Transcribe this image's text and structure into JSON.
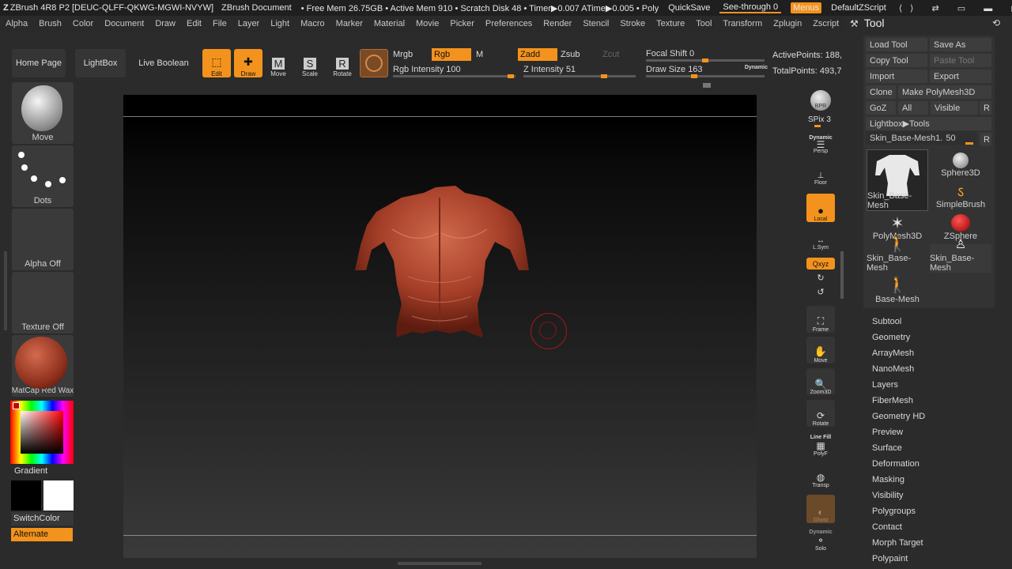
{
  "titlebar": {
    "app": "ZBrush 4R8 P2 [DEUC-QLFF-QKWG-MGWI-NVYW]",
    "document": "ZBrush Document",
    "mem": "• Free Mem 26.75GB • Active Mem 910 • Scratch Disk 48 • Timer▶0.007 ATime▶0.005 • Poly",
    "quicksave": "QuickSave",
    "seethrough": "See-through  0",
    "menus": "Menus",
    "zscript": "DefaultZScript"
  },
  "menubar": [
    "Alpha",
    "Brush",
    "Color",
    "Document",
    "Draw",
    "Edit",
    "File",
    "Layer",
    "Light",
    "Macro",
    "Marker",
    "Material",
    "Movie",
    "Picker",
    "Preferences",
    "Render",
    "Stencil",
    "Stroke",
    "Texture",
    "Tool",
    "Transform",
    "Zplugin",
    "Zscript"
  ],
  "shelf": {
    "home": "Home Page",
    "lightbox": "LightBox",
    "liveboolean": "Live Boolean",
    "edit": "Edit",
    "draw": "Draw",
    "move": "Move",
    "scale": "Scale",
    "rotate": "Rotate",
    "mrgb": "Mrgb",
    "rgb": "Rgb",
    "m": "M",
    "zadd": "Zadd",
    "zsub": "Zsub",
    "zcut": "Zcut",
    "rgb_intensity_label": "Rgb Intensity",
    "rgb_intensity": "100",
    "rgb_intensity_level": 1.0,
    "z_intensity_label": "Z Intensity",
    "z_intensity": "51",
    "z_intensity_level": 0.51,
    "focal_label": "Focal Shift",
    "focal": "0",
    "drawsize_label": "Draw Size",
    "drawsize": "163",
    "dynamic": "Dynamic",
    "activepoints": "ActivePoints: 188,",
    "totalpoints": "TotalPoints: 493,7"
  },
  "left": {
    "brush": "Move",
    "stroke": "Dots",
    "alpha": "Alpha Off",
    "texture": "Texture Off",
    "material": "MatCap Red Wax",
    "gradient": "Gradient",
    "switchcolor": "SwitchColor",
    "alternate": "Alternate"
  },
  "rightshelf": {
    "bpr": "BPR",
    "spix_label": "SPix",
    "spix": "3",
    "dynamic": "Dynamic",
    "persp": "Persp",
    "floor": "Floor",
    "local": "Local",
    "lsym": "L.Sym",
    "xyz": "Qxyz",
    "frame": "Frame",
    "move": "Move",
    "zoom": "Zoom3D",
    "rotate": "Rotate",
    "linefill": "Line Fill",
    "polyf": "PolyF",
    "transp": "Transp",
    "ghost": "Ghost",
    "dynamic2": "Dynamic",
    "solo": "Solo"
  },
  "toolpanel": {
    "title": "Tool",
    "load": "Load Tool",
    "saveas": "Save As",
    "copy": "Copy Tool",
    "paste": "Paste Tool",
    "import": "Import",
    "export": "Export",
    "clone": "Clone",
    "makepoly": "Make PolyMesh3D",
    "goz": "GoZ",
    "all": "All",
    "visible": "Visible",
    "r": "R",
    "lightboxtools": "Lightbox▶Tools",
    "current_label": "Skin_Base-Mesh1.",
    "current_value": "50",
    "r2": "R",
    "thumbs": [
      "Skin_Base-Mesh",
      "Sphere3D",
      "SimpleBrush",
      "PolyMesh3D",
      "ZSphere",
      "Skin_Base-Mesh",
      "Skin_Base-Mesh",
      "Base-Mesh"
    ]
  },
  "subpalettes": [
    "Subtool",
    "Geometry",
    "ArrayMesh",
    "NanoMesh",
    "Layers",
    "FiberMesh",
    "Geometry HD",
    "Preview",
    "Surface",
    "Deformation",
    "Masking",
    "Visibility",
    "Polygroups",
    "Contact",
    "Morph Target",
    "Polypaint"
  ],
  "colors": {
    "accent": "#f3931d",
    "bg": "#2b2b2b",
    "model": "#b04a32"
  }
}
